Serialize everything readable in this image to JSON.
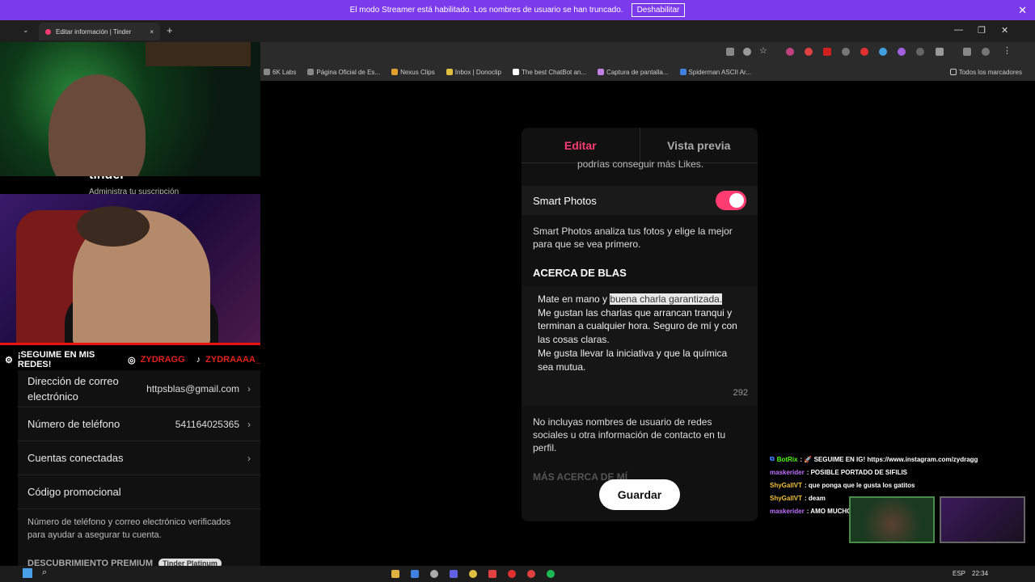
{
  "banner": {
    "message": "El modo Streamer está habilitado. Los nombres de usuario se han truncado.",
    "button": "Deshabilitar",
    "close": "✕"
  },
  "browser": {
    "tab_title": "Editar información | Tinder",
    "tab_close": "×",
    "new_tab": "+",
    "bookmarks": [
      "6K Labs",
      "Página Oficial de Es...",
      "Nexus Clips",
      "Inbox | Donoclip",
      "The best ChatBot an...",
      "Captura de pantalla...",
      "Spiderman ASCII Ar..."
    ],
    "all_bookmarks": "Todos los marcadores"
  },
  "overlay": {
    "tinder_brand": "tinder",
    "subscription_note": "Administra tu suscripción",
    "social_cta": "¡SEGUIME EN MIS REDES!",
    "instagram_handle": "ZYDRAGG",
    "tiktok_handle": "ZYDRAAAA_"
  },
  "settings": {
    "rows": [
      {
        "label": "Dirección de correo electrónico",
        "value": "httpsblas@gmail.com"
      },
      {
        "label": "Número de teléfono",
        "value": "541164025365"
      },
      {
        "label": "Cuentas conectadas",
        "value": ""
      },
      {
        "label": "Código promocional",
        "value": ""
      }
    ],
    "verified_note": "Número de teléfono y correo electrónico verificados para ayudar a asegurar tu cuenta.",
    "premium_section": "DESCUBRIMIENTO PREMIUM",
    "premium_badge": "Tinder Platinum"
  },
  "editor": {
    "tab_edit": "Editar",
    "tab_preview": "Vista previa",
    "cut_text": "podrías conseguir más Likes.",
    "smart_photos_label": "Smart Photos",
    "smart_photos_on": true,
    "smart_photos_desc": "Smart Photos analiza tus fotos y elige la mejor para que se vea primero.",
    "about_heading": "ACERCA DE BLAS",
    "about_pre": "Mate en mano y ",
    "about_highlight": "buena charla garantizada.",
    "about_rest": "Me gustan las charlas que arrancan tranqui y terminan a cualquier hora. Seguro de mí y con las cosas claras.\nMe gusta llevar la iniciativa y que la química sea mutua.",
    "char_count": "292",
    "social_warning": "No incluyas nombres de usuario de redes sociales u otra información de contacto en tu perfil.",
    "more_about_heading": "MÁS ACERCA DE MÍ",
    "save_button": "Guardar"
  },
  "chat": [
    {
      "user": "BotRix",
      "message": ": 🚀 SEGUIME EN IG! https://www.instagram.com/zydragg",
      "role": "bot"
    },
    {
      "user": "maskerider",
      "message": ": POSIBLE PORTADO DE SIFILIS",
      "role": "mask"
    },
    {
      "user": "ShyGallVT",
      "message": ": que ponga que le gusta los gatitos",
      "role": "shy"
    },
    {
      "user": "ShyGallVT",
      "message": ": deam",
      "role": "shy"
    },
    {
      "user": "maskerider",
      "message": ": AMO MUCHO A TAYLOR SWIFT",
      "role": "mask"
    }
  ],
  "taskbar": {
    "lang": "ESP",
    "time": "22:34"
  },
  "colors": {
    "tinder_pink": "#fe3c72",
    "streamer_purple": "#7c3aed",
    "social_red": "#e02020"
  }
}
